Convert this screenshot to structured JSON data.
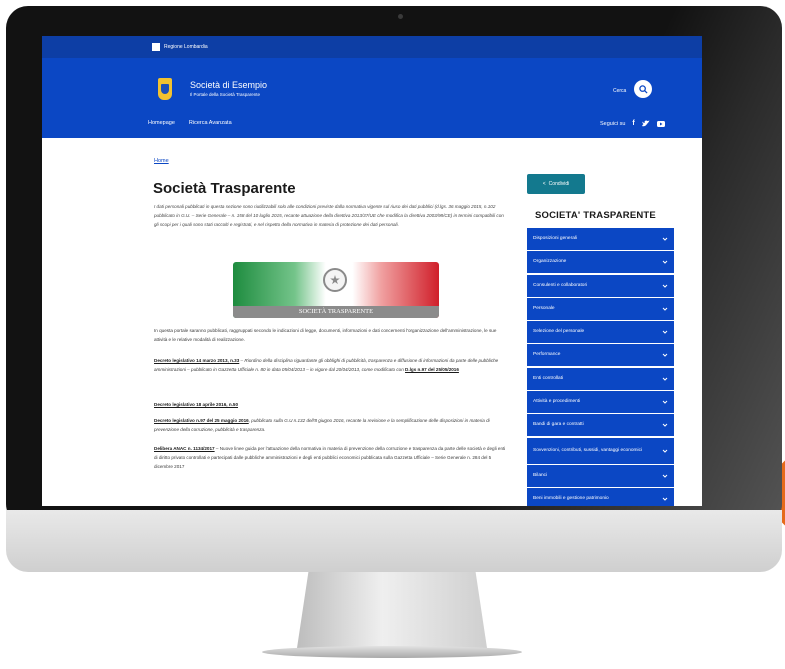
{
  "topbar": {
    "label": "Regione Lombardia"
  },
  "header": {
    "org_name": "Società di Esempio",
    "org_subtitle": "Il Portale della Società Trasparente",
    "search_label": "Cerca",
    "nav": [
      "Homepage",
      "Ricerca Avanzata"
    ],
    "social_label": "Seguici su",
    "social_icons": [
      "facebook-icon",
      "twitter-icon",
      "youtube-icon"
    ]
  },
  "main": {
    "breadcrumb": "Home",
    "title": "Società Trasparente",
    "intro": "I dati personali pubblicati in questa sezione sono riutilizzabili solo alle condizioni previste dalla normativa vigente sul riuso dei dati pubblici (d.lgs. 36 maggio 2015, n.102 pubblicato in G.U. – Serie Generale – n. 158 del 10 luglio 2015, recante attuazione della direttiva 2013/37/UE che modifica la direttiva 2003/98/CE) in termini compatibili con gli scopi per i quali sono stati raccolti e registrati, e nel rispetto della normativa in materia di protezione dei dati personali.",
    "banner_caption": "SOCIETÀ TRASPARENTE",
    "p1": "In questa portale saranno pubblicati, raggruppati secondo le indicazioni di legge, documenti, informazioni e dati concernenti l'organizzazione dell'amministrazione, le sue attività e le relative modalità di realizzazione.",
    "p2_link": "Decreto legislativo 14 marzo 2013, n.33",
    "p2_text": " – Riordino della disciplina riguardante gli obblighi di pubblicità, trasparenza e diffusione di informazioni da parte delle pubbliche amministrazioni – pubblicato in Gazzetta Ufficiale n. 80 in data 05/04/2013 – in vigore dal 20/04/2013, come modificato con ",
    "p2_link2": "D.lgs n.97 del 25/05/2016",
    "p3_link": "Decreto legislativo 18 aprile 2016, n.50",
    "p4_link": "Decreto legislativo n.97 del 25 maggio 2016",
    "p4_text": ", pubblicato sulla G.U n.132 dell'8 giugno 2016, recante la revisione e la semplificazione delle disposizioni in materia di prevenzione della corruzione, pubblicità e trasparenza.",
    "p5_link": "Delibera ANAC n. 1134/2017",
    "p5_text": " – Nuove linee guida per l'attuazione della normativa in materia di prevenzione della corruzione e trasparenza da parte delle società e degli enti di diritto privato controllati e partecipati dalle pubbliche amministrazioni e degli enti pubblici economici pubblicata sulla Gazzetta Ufficiale – Serie Generale n. 284 del 5 dicembre 2017"
  },
  "sidebar": {
    "share_label": "Condividi",
    "title": "SOCIETA' TRASPARENTE",
    "items": [
      "Disposizioni generali",
      "Organizzazione",
      "Consulenti e collaboratori",
      "Personale",
      "Selezione del personale",
      "Performance",
      "Enti controllati",
      "Attività e procedimenti",
      "Bandi di gara e contratti",
      "Sovvenzioni, contributi, sussidi, vantaggi economici",
      "Bilanci",
      "Beni immobili e gestione patrimonio"
    ]
  },
  "colors": {
    "primary_blue": "#0b47c4",
    "teal": "#13798e",
    "accent_orange": "#e56a1b"
  }
}
